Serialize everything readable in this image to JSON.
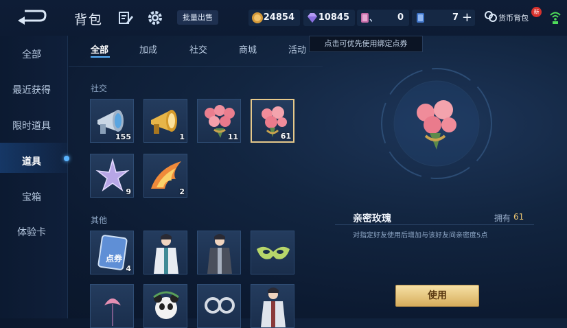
{
  "header": {
    "title": "背包",
    "batch_sell": "批量出售",
    "resources": [
      {
        "icon": "gold-coin-icon",
        "value": "24854"
      },
      {
        "icon": "diamond-icon",
        "value": "10845"
      },
      {
        "icon": "bound-voucher-icon",
        "value": "0"
      },
      {
        "icon": "voucher-card-icon",
        "value": "7"
      }
    ],
    "plus": "+",
    "wallet_label": "货币背包",
    "new_badge": "新"
  },
  "tooltip": "点击可优先使用绑定点券",
  "sidebar": {
    "items": [
      {
        "label": "全部"
      },
      {
        "label": "最近获得"
      },
      {
        "label": "限时道具"
      },
      {
        "label": "道具"
      },
      {
        "label": "宝箱"
      },
      {
        "label": "体验卡"
      }
    ],
    "active_index": 3
  },
  "tabs": [
    {
      "label": "全部"
    },
    {
      "label": "加成"
    },
    {
      "label": "社交"
    },
    {
      "label": "商城"
    },
    {
      "label": "活动"
    }
  ],
  "sections": {
    "social": {
      "label": "社交",
      "items": [
        {
          "name": "silver-megaphone",
          "count": "155"
        },
        {
          "name": "gold-megaphone",
          "count": "1"
        },
        {
          "name": "rose-bouquet-large",
          "count": "11"
        },
        {
          "name": "intimate-rose",
          "count": "61"
        },
        {
          "name": "star-crystal",
          "count": "9"
        },
        {
          "name": "flame-firework",
          "count": "2"
        }
      ]
    },
    "other": {
      "label": "其他",
      "items": [
        {
          "name": "voucher-card",
          "count": "4",
          "card_text": "点券"
        },
        {
          "name": "hero-white-robe",
          "count": ""
        },
        {
          "name": "hero-dark-robe",
          "count": ""
        },
        {
          "name": "green-mask",
          "count": ""
        },
        {
          "name": "pink-flower",
          "count": ""
        },
        {
          "name": "panda-doll",
          "count": ""
        },
        {
          "name": "silver-goggles",
          "count": ""
        },
        {
          "name": "hero-scholar",
          "count": ""
        }
      ]
    }
  },
  "detail": {
    "name": "亲密玫瑰",
    "own_label": "拥有",
    "own_count": "61",
    "description": "对指定好友使用后增加与该好友间亲密度5点",
    "use_button": "使用"
  },
  "colors": {
    "accent": "#5ab4ff",
    "gold": "#e9c470",
    "button": "#e8c77e"
  }
}
